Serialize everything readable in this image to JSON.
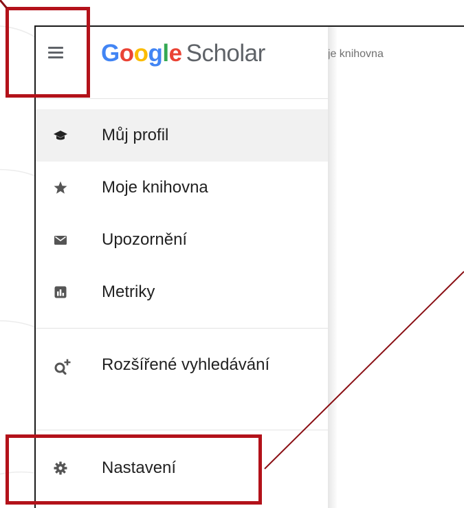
{
  "header": {
    "logo": {
      "letters": [
        "G",
        "o",
        "o",
        "g",
        "l",
        "e"
      ],
      "product": "Scholar"
    },
    "menu_icon": "hamburger-menu-icon"
  },
  "page": {
    "breadcrumb_fragment": "oje knihovna"
  },
  "drawer": {
    "items": [
      {
        "label": "Můj profil",
        "icon": "graduation-cap-icon",
        "active": true
      },
      {
        "label": "Moje knihovna",
        "icon": "star-icon",
        "active": false
      },
      {
        "label": "Upozornění",
        "icon": "envelope-icon",
        "active": false
      },
      {
        "label": "Metriky",
        "icon": "metrics-chart-icon",
        "active": false
      },
      {
        "label": "Rozšířené vyhledávání",
        "icon": "advanced-search-icon",
        "active": false
      },
      {
        "label": "Nastavení",
        "icon": "gear-icon",
        "active": false
      }
    ]
  },
  "colors": {
    "annotation": "#b3121a",
    "google_blue": "#4285f4",
    "google_red": "#ea4335",
    "google_yellow": "#fbbc05",
    "google_green": "#34a853",
    "active_row": "#f1f1f1"
  }
}
